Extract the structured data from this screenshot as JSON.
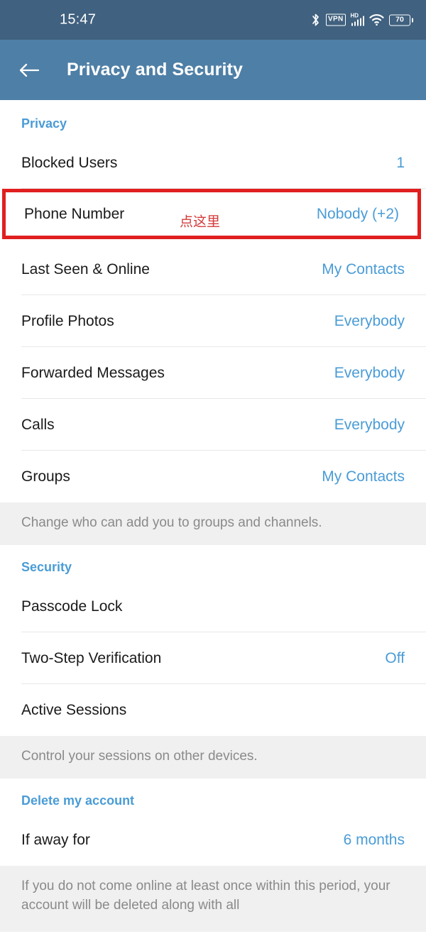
{
  "statusbar": {
    "time": "15:47",
    "icons": [
      "bluetooth-icon",
      "vpn-icon",
      "hd-signal-icon",
      "wifi-icon",
      "battery-icon"
    ],
    "vpn_label": "VPN",
    "hd_label": "HD",
    "battery_level": "70"
  },
  "appbar": {
    "back_icon": "back-arrow-icon",
    "title": "Privacy and Security",
    "background": "#4e7fa6"
  },
  "colors": {
    "accent_blue": "#4a9cd6",
    "statusbar": "#40617f",
    "highlight_red": "#e01f1f",
    "annotation_red": "#d43a3a",
    "info_band": "#f0f0f0",
    "muted_text": "#8a8a8a"
  },
  "sections": {
    "privacy": {
      "header": "Privacy",
      "rows": [
        {
          "label": "Blocked Users",
          "value": "1"
        },
        {
          "label": "Phone Number",
          "value": "Nobody (+2)",
          "annotation": "点这里",
          "highlighted": true
        },
        {
          "label": "Last Seen & Online",
          "value": "My Contacts"
        },
        {
          "label": "Profile Photos",
          "value": "Everybody"
        },
        {
          "label": "Forwarded Messages",
          "value": "Everybody"
        },
        {
          "label": "Calls",
          "value": "Everybody"
        },
        {
          "label": "Groups",
          "value": "My Contacts"
        }
      ],
      "footnote": "Change who can add you to groups and channels."
    },
    "security": {
      "header": "Security",
      "rows": [
        {
          "label": "Passcode Lock",
          "value": ""
        },
        {
          "label": "Two-Step Verification",
          "value": "Off"
        },
        {
          "label": "Active Sessions",
          "value": ""
        }
      ],
      "footnote": "Control your sessions on other devices."
    },
    "delete_account": {
      "header": "Delete my account",
      "rows": [
        {
          "label": "If away for",
          "value": "6 months"
        }
      ],
      "footnote": "If you do not come online at least once within this period, your account will be deleted along with all"
    }
  }
}
